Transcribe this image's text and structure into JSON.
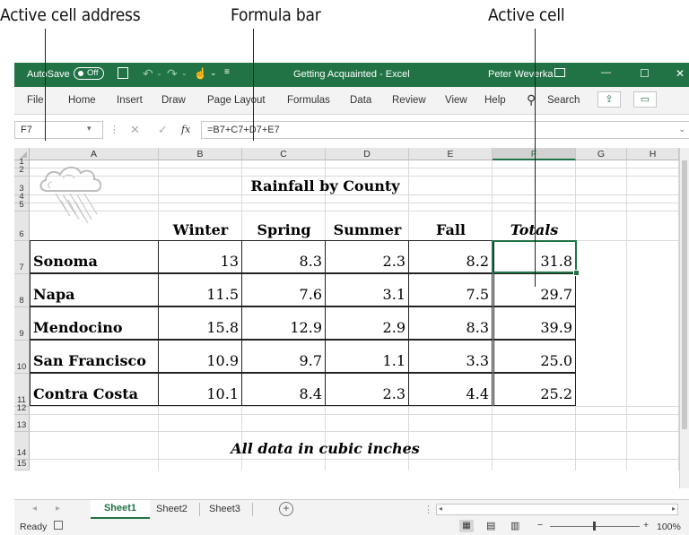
{
  "annotations": {
    "active_cell_address": "Active cell address",
    "formula_bar": "Formula bar",
    "active_cell": "Active cell"
  },
  "titlebar": {
    "autosave_label": "AutoSave",
    "autosave_state": "Off",
    "title": "Getting Acquainted - Excel",
    "user": "Peter Weverka",
    "minimize": "—",
    "restore": "☐",
    "close": "✕"
  },
  "ribbon": {
    "tabs": [
      "File",
      "Home",
      "Insert",
      "Draw",
      "Page Layout",
      "Formulas",
      "Data",
      "Review",
      "View",
      "Help"
    ],
    "search_label": "Search"
  },
  "formula_bar": {
    "name_box": "F7",
    "fx": "fx",
    "formula": "=B7+C7+D7+E7"
  },
  "grid": {
    "columns": [
      "A",
      "B",
      "C",
      "D",
      "E",
      "F",
      "G",
      "H"
    ],
    "rows": [
      "1",
      "2",
      "3",
      "4",
      "5",
      "6",
      "7",
      "8",
      "9",
      "10",
      "11",
      "12",
      "13",
      "14",
      "15"
    ],
    "title": "Rainfall by County",
    "headers": [
      "Winter",
      "Spring",
      "Summer",
      "Fall",
      "Totals"
    ],
    "data": [
      {
        "county": "Sonoma",
        "values": [
          "13",
          "8.3",
          "2.3",
          "8.2",
          "31.8"
        ]
      },
      {
        "county": "Napa",
        "values": [
          "11.5",
          "7.6",
          "3.1",
          "7.5",
          "29.7"
        ]
      },
      {
        "county": "Mendocino",
        "values": [
          "15.8",
          "12.9",
          "2.9",
          "8.3",
          "39.9"
        ]
      },
      {
        "county": "San Francisco",
        "values": [
          "10.9",
          "9.7",
          "1.1",
          "3.3",
          "25.0"
        ]
      },
      {
        "county": "Contra Costa",
        "values": [
          "10.1",
          "8.4",
          "2.3",
          "4.4",
          "25.2"
        ]
      }
    ],
    "footer_note": "All data in cubic inches"
  },
  "sheet_tabs": [
    "Sheet1",
    "Sheet2",
    "Sheet3"
  ],
  "status": {
    "ready": "Ready",
    "zoom": "100%"
  }
}
